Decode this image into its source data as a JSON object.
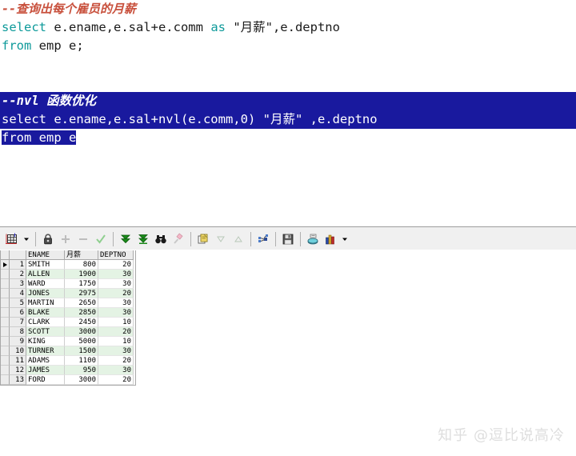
{
  "editor": {
    "block1": {
      "comment": "--查询出每个雇员的月薪",
      "line1_kw": "select",
      "line1_rest": " e.ename,e.sal+e.comm ",
      "line1_kw2": "as",
      "line1_tail": " \"月薪\",e.deptno",
      "line2_kw": "from",
      "line2_rest": " emp e;"
    },
    "block2_selected": {
      "comment": "--nvl 函数优化",
      "line1": "select e.ename,e.sal+nvl(e.comm,0) \"月薪\" ,e.deptno",
      "line2_selected": "from emp e"
    }
  },
  "toolbar": {
    "buttons": [
      {
        "name": "grid-layout-icon",
        "title": "Grid"
      },
      {
        "name": "chevron-down-icon",
        "title": "Grid options"
      },
      {
        "name": "lock-icon",
        "title": "Lock record"
      },
      {
        "name": "plus-icon",
        "title": "Insert record"
      },
      {
        "name": "minus-icon",
        "title": "Delete record"
      },
      {
        "name": "check-icon",
        "title": "Post changes"
      },
      {
        "name": "fetch-next-page-icon",
        "title": "Fetch next page"
      },
      {
        "name": "fetch-last-page-icon",
        "title": "Fetch last page"
      },
      {
        "name": "binoculars-icon",
        "title": "Find"
      },
      {
        "name": "eraser-icon",
        "title": "Clear"
      },
      {
        "name": "copy-to-clipboard-icon",
        "title": "Copy"
      },
      {
        "name": "sort-descending-icon",
        "title": "Sort descending"
      },
      {
        "name": "sort-ascending-icon",
        "title": "Sort ascending"
      },
      {
        "name": "plug-connection-icon",
        "title": "Connection"
      },
      {
        "name": "save-disk-icon",
        "title": "Save"
      },
      {
        "name": "export-data-icon",
        "title": "Export"
      },
      {
        "name": "chart-icon",
        "title": "Chart"
      },
      {
        "name": "chevron-down-icon-2",
        "title": "Chart options"
      }
    ]
  },
  "grid": {
    "columns": [
      "ENAME",
      "月薪",
      "DEPTNO"
    ],
    "rows": [
      {
        "n": "1",
        "ename": "SMITH",
        "sal": "800",
        "deptno": "20",
        "current": true
      },
      {
        "n": "2",
        "ename": "ALLEN",
        "sal": "1900",
        "deptno": "30"
      },
      {
        "n": "3",
        "ename": "WARD",
        "sal": "1750",
        "deptno": "30"
      },
      {
        "n": "4",
        "ename": "JONES",
        "sal": "2975",
        "deptno": "20"
      },
      {
        "n": "5",
        "ename": "MARTIN",
        "sal": "2650",
        "deptno": "30"
      },
      {
        "n": "6",
        "ename": "BLAKE",
        "sal": "2850",
        "deptno": "30"
      },
      {
        "n": "7",
        "ename": "CLARK",
        "sal": "2450",
        "deptno": "10"
      },
      {
        "n": "8",
        "ename": "SCOTT",
        "sal": "3000",
        "deptno": "20"
      },
      {
        "n": "9",
        "ename": "KING",
        "sal": "5000",
        "deptno": "10"
      },
      {
        "n": "10",
        "ename": "TURNER",
        "sal": "1500",
        "deptno": "30"
      },
      {
        "n": "11",
        "ename": "ADAMS",
        "sal": "1100",
        "deptno": "20"
      },
      {
        "n": "12",
        "ename": "JAMES",
        "sal": "950",
        "deptno": "30"
      },
      {
        "n": "13",
        "ename": "FORD",
        "sal": "3000",
        "deptno": "20"
      }
    ]
  },
  "watermark": {
    "text": "知乎 @逗比说高冷"
  },
  "colors": {
    "selection_bg": "#19199e",
    "comment_red": "#c8503c",
    "keyword_teal": "#0e9a9a",
    "alt_row_green": "#e4f3e4",
    "toolbar_bg": "#f0f0f0"
  }
}
